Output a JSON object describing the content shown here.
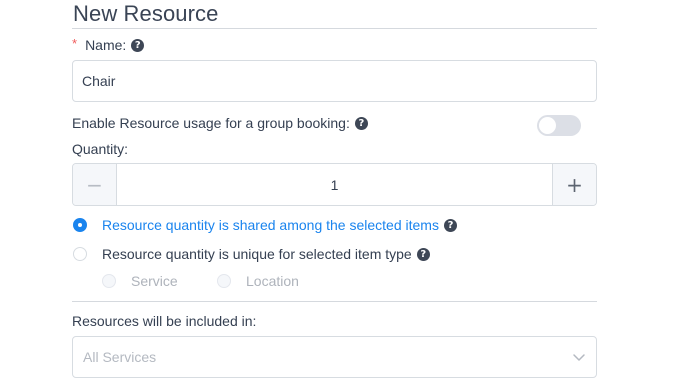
{
  "header": {
    "title": "New Resource"
  },
  "name_field": {
    "required_mark": "*",
    "label": "Name:",
    "value": "Chair"
  },
  "group_booking": {
    "label": "Enable Resource usage for a group booking:",
    "enabled": false
  },
  "quantity": {
    "label": "Quantity:",
    "value": "1",
    "decrement_icon": "minus-icon",
    "increment_icon": "plus-icon"
  },
  "sharing": {
    "options": [
      {
        "label": "Resource quantity is shared among the selected items",
        "selected": true
      },
      {
        "label": "Resource quantity is unique for selected item type",
        "selected": false
      }
    ],
    "sub_options": [
      {
        "label": "Service",
        "disabled": true
      },
      {
        "label": "Location",
        "disabled": true
      }
    ]
  },
  "included_in": {
    "label": "Resources will be included in:",
    "placeholder": "All Services",
    "icon": "chevron-down-icon"
  },
  "colors": {
    "accent": "#1a84ee",
    "required": "#f05a5a",
    "text": "#354052",
    "border": "#d7dce1"
  }
}
